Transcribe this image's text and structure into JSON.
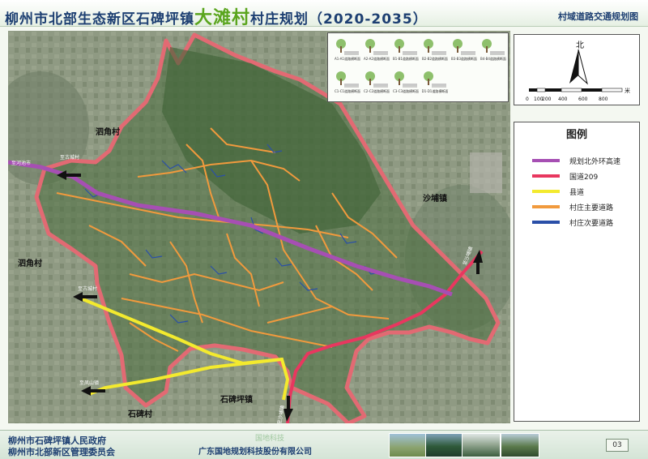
{
  "header": {
    "title_prefix": "柳州市北部生态新区石碑坪镇",
    "title_highlight": "大滩村",
    "title_suffix": "村庄规划（2020-2035）",
    "subtitle": "村域道路交通规划图"
  },
  "place_labels": {
    "sijiao_n": "泗角村",
    "sijiao_w": "泗角村",
    "shabu": "沙埔镇",
    "shibeiping_town": "石碑坪镇",
    "shibeiping_village": "石碑村"
  },
  "direction_labels": {
    "to_hechi": "至河池市",
    "to_gucheng_1": "至古城村",
    "to_gucheng_2": "至古城村",
    "to_fengshan": "至凤山镇",
    "to_shabu_1": "至沙埔镇",
    "to_shabu_2": "至沙埔镇"
  },
  "north_arrow": {
    "label": "北"
  },
  "scale_bar": {
    "ticks": [
      "0",
      "100",
      "200",
      "400",
      "600",
      "800"
    ],
    "unit": "米"
  },
  "legend": {
    "title": "图例",
    "items": [
      {
        "label": "规划北外环高速",
        "color": "#a64fb3"
      },
      {
        "label": "国道209",
        "color": "#e8375f"
      },
      {
        "label": "县道",
        "color": "#f3ea2e"
      },
      {
        "label": "村庄主要道路",
        "color": "#f19a3d"
      },
      {
        "label": "村庄次要道路",
        "color": "#2a4fa8"
      }
    ]
  },
  "cross_sections": {
    "row1": [
      "A1-A1道路横断面",
      "A2-A2道路横断面",
      "B1-B1道路横断面",
      "B2-B2道路横断面",
      "B3-B3道路横断面",
      "B4-B4道路横断面"
    ],
    "row2": [
      "C1-C1道路横断面",
      "C2-C2道路横断面",
      "C3-C3道路横断面",
      "D1-D1道路横断面"
    ]
  },
  "footer": {
    "org1": "柳州市石碑坪镇人民政府",
    "org2": "柳州市北部新区管理委员会",
    "designer": "广东国地规划科技股份有限公司",
    "watermark": "国地科技",
    "page": "03"
  }
}
